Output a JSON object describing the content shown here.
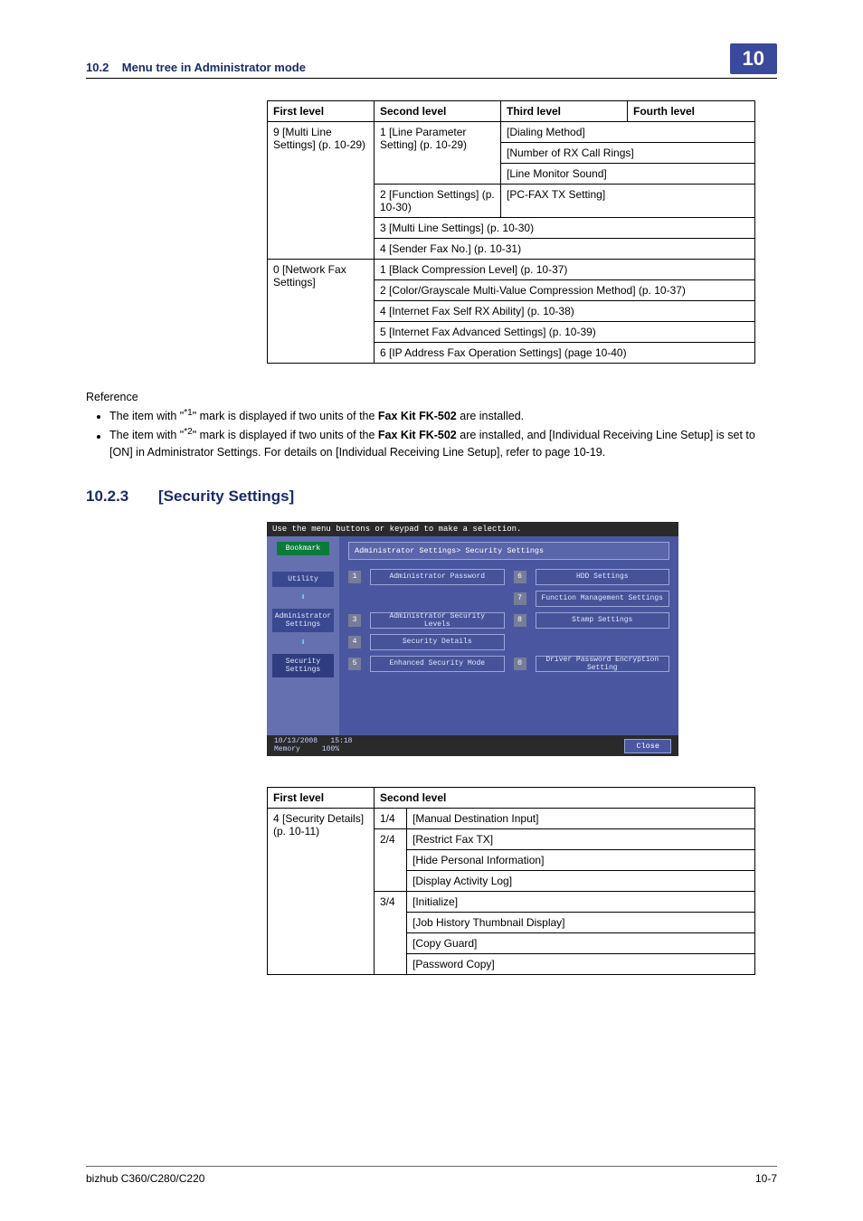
{
  "header": {
    "section_ref": "10.2",
    "title": "Menu tree in Administrator mode",
    "chapter": "10"
  },
  "menu_table": {
    "headers": {
      "c1": "First level",
      "c2": "Second level",
      "c3": "Third level",
      "c4": "Fourth level"
    },
    "r1c1": "9 [Multi Line Settings] (p. 10-29)",
    "r1c2": "1 [Line Parameter Setting] (p. 10-29)",
    "r1c3": "[Dialing Method]",
    "r2c3": "[Number of RX Call Rings]",
    "r3c3": "[Line Monitor Sound]",
    "r4c2": "2 [Function Settings] (p. 10-30)",
    "r4c3": "[PC-FAX TX Setting]",
    "r5c2": "3 [Multi Line Settings] (p. 10-30)",
    "r6c2": "4 [Sender Fax No.] (p. 10-31)",
    "r7c1": "0 [Network Fax Settings]",
    "r7c2": "1 [Black Compression Level] (p. 10-37)",
    "r8c2": "2 [Color/Grayscale Multi-Value Compression Method] (p. 10-37)",
    "r9c2": "4 [Internet Fax Self RX Ability] (p. 10-38)",
    "r10c2": "5 [Internet Fax Advanced Settings] (p. 10-39)",
    "r11c2": "6 [IP Address Fax Operation Settings] (page 10-40)"
  },
  "reference": {
    "title": "Reference",
    "item1_pre": "The item with \"",
    "item1_sup": "*1",
    "item1_post": "\" mark is displayed if two units of the ",
    "item1_bold": "Fax Kit FK-502",
    "item1_end": " are installed.",
    "item2_pre": "The item with \"",
    "item2_sup": "*2",
    "item2_post": "\" mark is displayed if two units of the ",
    "item2_bold": "Fax Kit FK-502",
    "item2_end": " are installed, and [Individual Receiving Line Setup] is set to [ON] in Administrator Settings. For details on [Individual Receiving Line Setup], refer to page 10-19."
  },
  "section": {
    "num": "10.2.3",
    "title": "[Security Settings]"
  },
  "screenshot": {
    "top_hint": "Use the menu buttons or keypad to make a selection.",
    "bookmark": "Bookmark",
    "left_tabs": {
      "utility": "Utility",
      "admin": "Administrator Settings",
      "security": "Security Settings"
    },
    "breadcrumb": "Administrator Settings> Security Settings",
    "btns": {
      "b1": "Administrator Password",
      "b6": "HDD Settings",
      "b7": "Function Management Settings",
      "b3": "Administrator Security Levels",
      "b8": "Stamp Settings",
      "b4": "Security Details",
      "b5": "Enhanced Security Mode",
      "b0": "Driver Password Encryption Setting"
    },
    "date": "10/13/2008",
    "time": "15:18",
    "memory": "Memory",
    "mempct": "100%",
    "close": "Close"
  },
  "sec2_table": {
    "headers": {
      "c1": "First level",
      "c2": "Second level"
    },
    "c1": "4 [Security Details] (p. 10-11)",
    "g1": "1/4",
    "g1v": "[Manual Destination Input]",
    "g2": "2/4",
    "g2v1": "[Restrict Fax TX]",
    "g2v2": "[Hide Personal Information]",
    "g2v3": "[Display Activity Log]",
    "g3": "3/4",
    "g3v1": "[Initialize]",
    "g3v2": "[Job History Thumbnail Display]",
    "g3v3": "[Copy Guard]",
    "g3v4": "[Password Copy]"
  },
  "footer": {
    "product": "bizhub C360/C280/C220",
    "page": "10-7"
  }
}
